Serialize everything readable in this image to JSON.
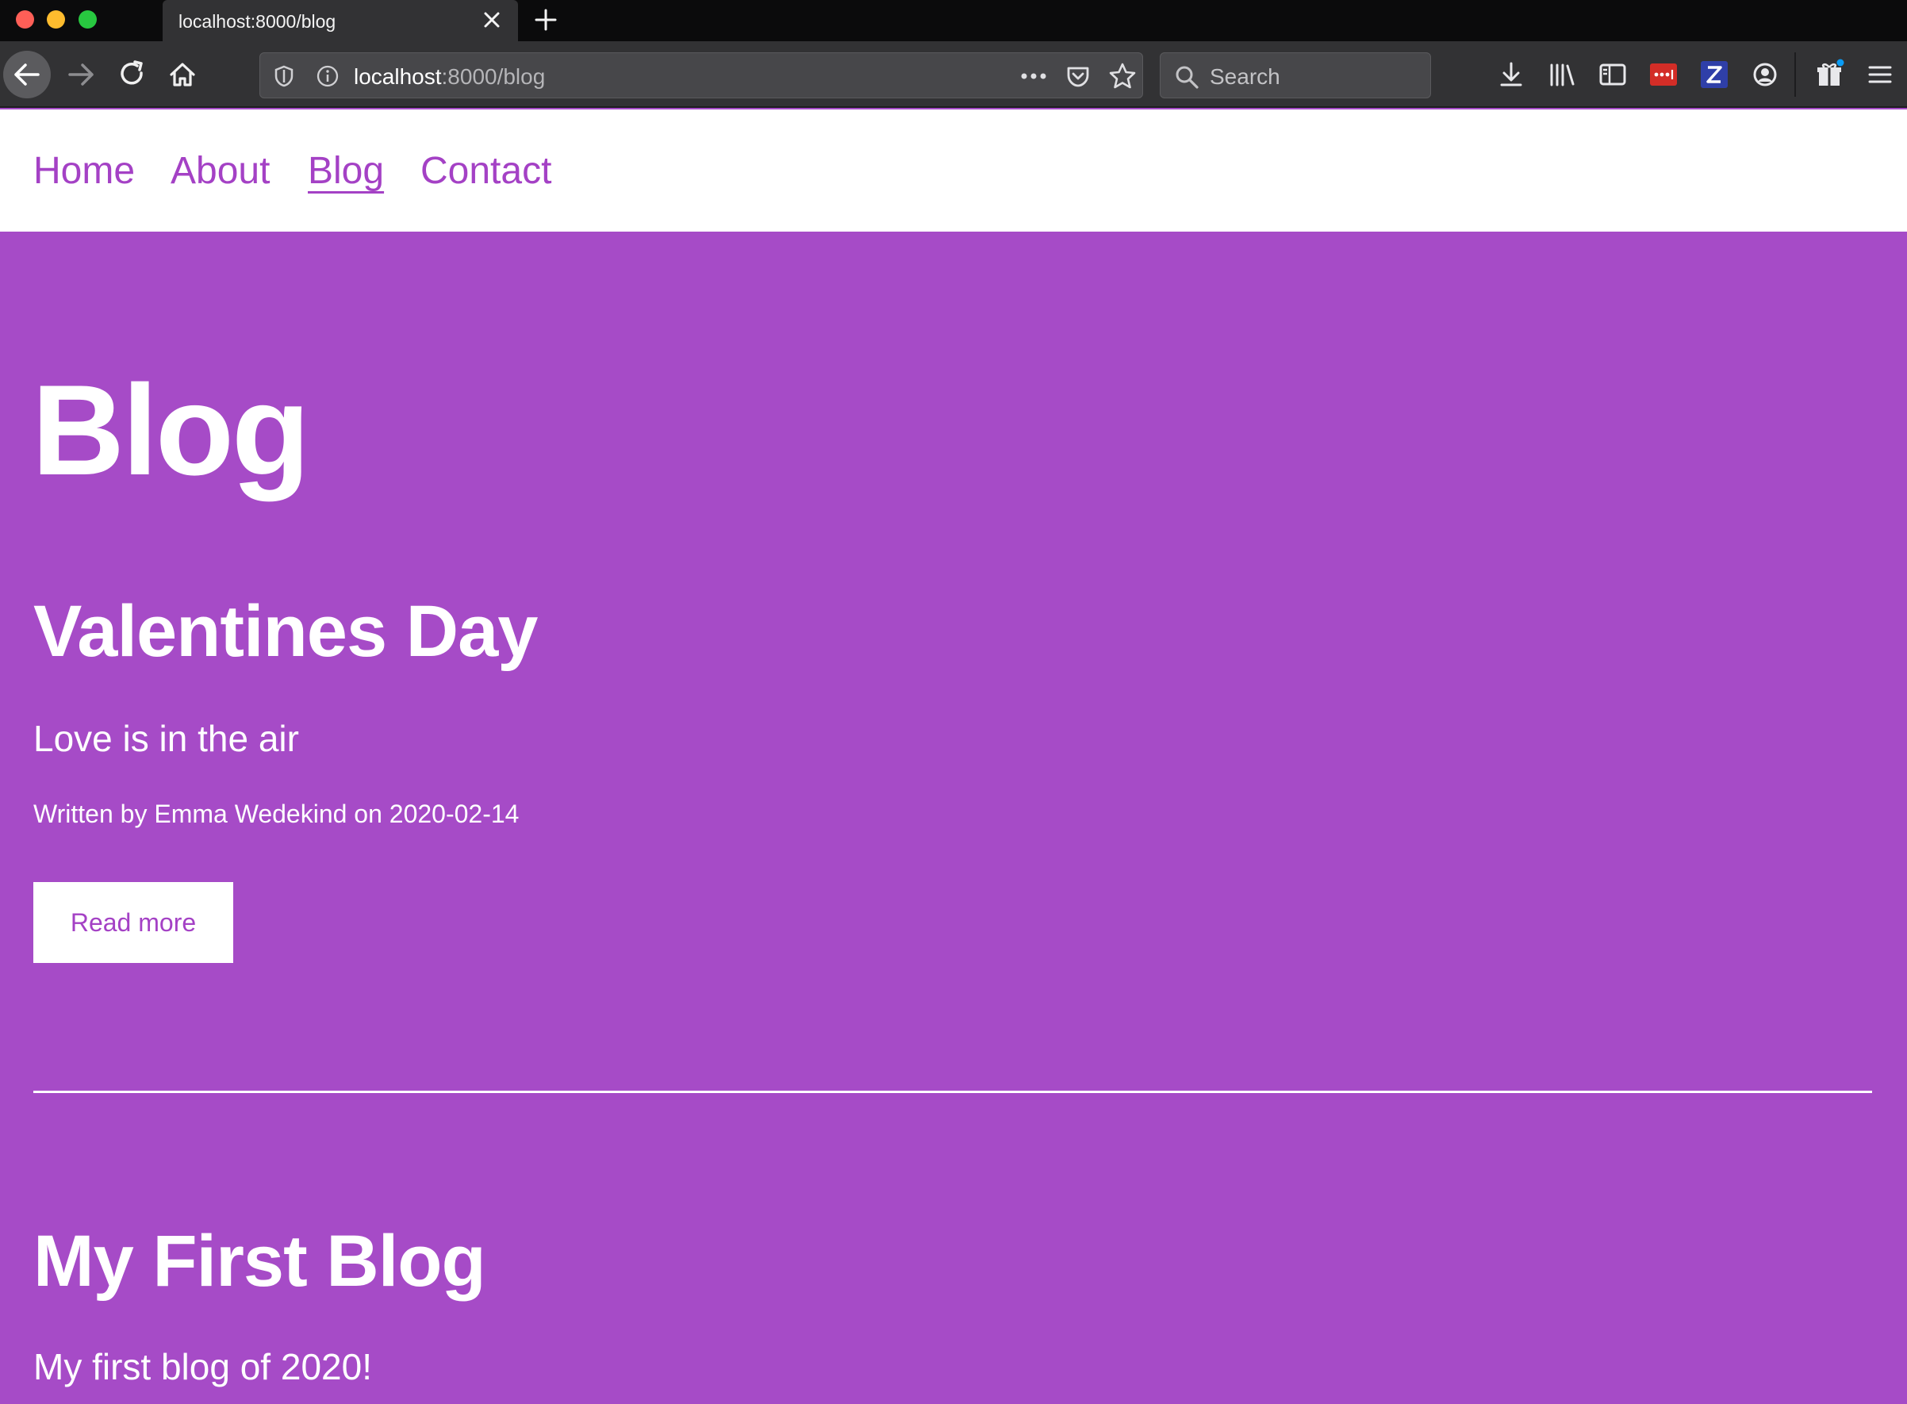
{
  "browser": {
    "tab_title": "localhost:8000/blog",
    "url_host": "localhost",
    "url_rest": ":8000/blog",
    "search_placeholder": "Search",
    "icons": [
      "back-arrow-icon",
      "forward-arrow-icon",
      "reload-icon",
      "home-icon",
      "shield-icon",
      "info-icon",
      "more-dots-icon",
      "pocket-icon",
      "star-icon",
      "search-icon",
      "download-icon",
      "library-icon",
      "sidebar-icon",
      "lastpass-icon",
      "zotero-icon",
      "account-icon",
      "gift-icon",
      "menu-icon"
    ]
  },
  "site_nav": {
    "links": [
      {
        "label": "Home"
      },
      {
        "label": "About"
      },
      {
        "label": "Blog"
      },
      {
        "label": "Contact"
      }
    ],
    "active": "Blog",
    "link_color": "#a441c5"
  },
  "page": {
    "title": "Blog",
    "background": "#a64bc7",
    "posts": [
      {
        "title": "Valentines Day",
        "subtitle": "Love is in the air",
        "meta": "Written by Emma Wedekind on 2020-02-14",
        "button": "Read more"
      },
      {
        "title": "My First Blog",
        "subtitle": "My first blog of 2020!"
      }
    ]
  }
}
